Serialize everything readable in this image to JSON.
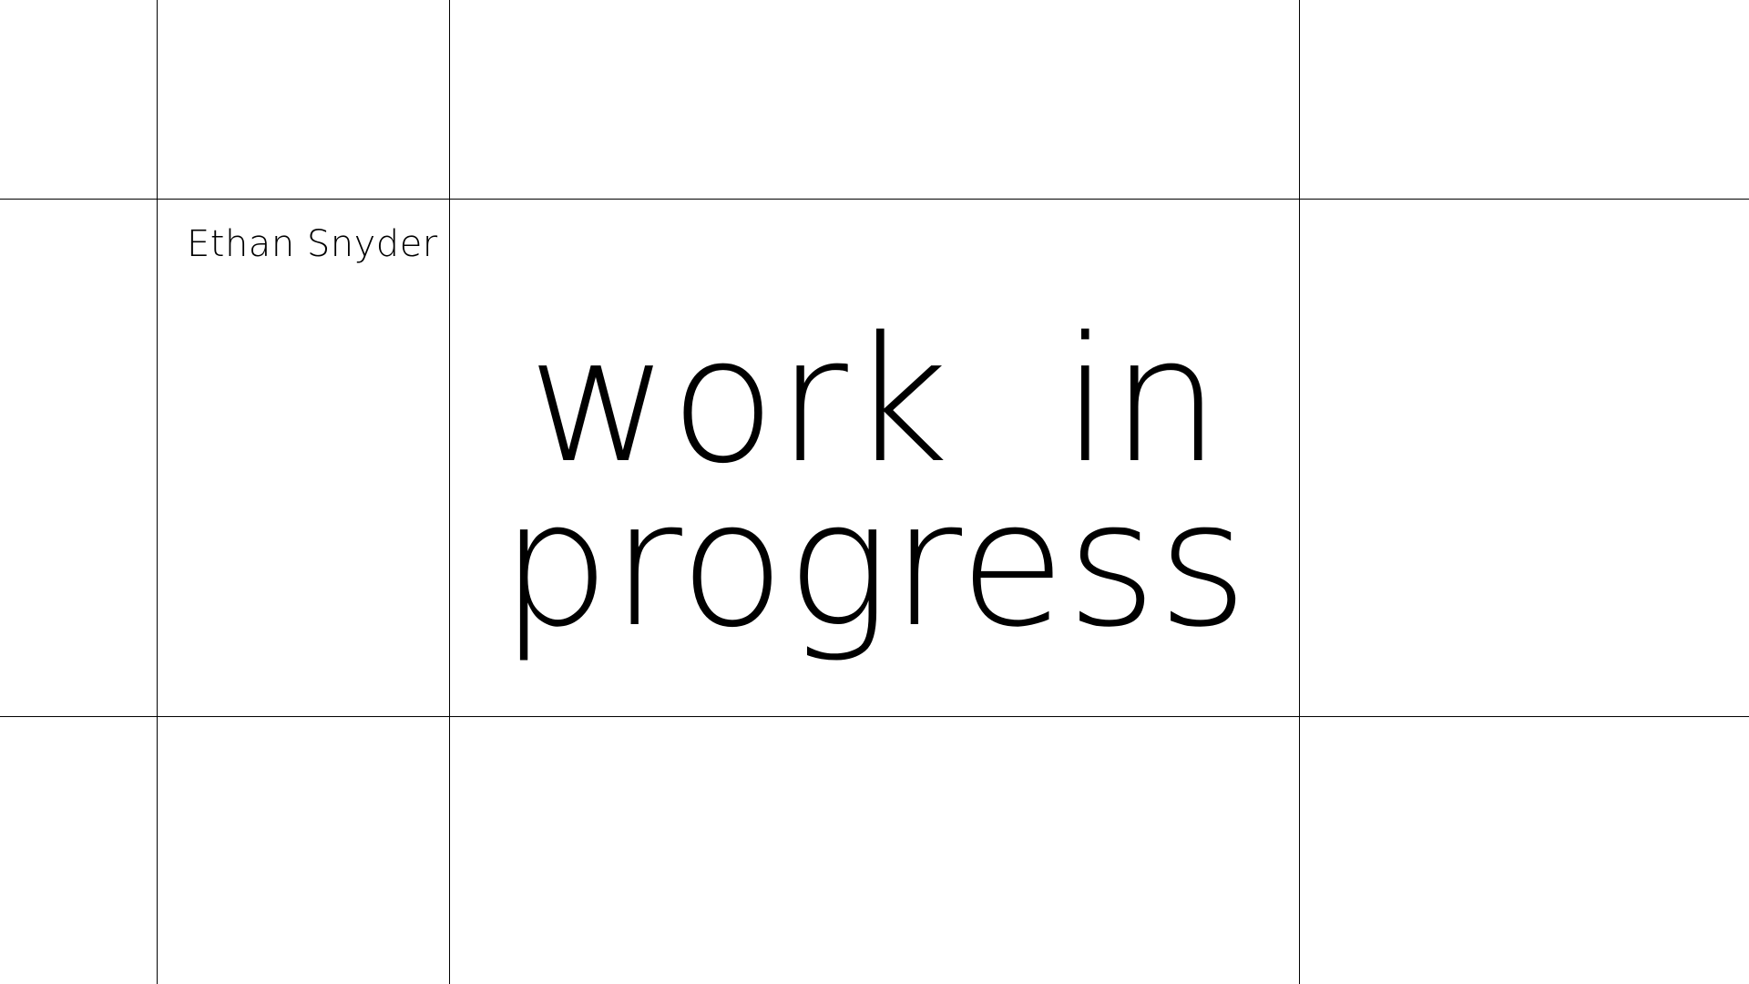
{
  "author": {
    "name": "Ethan Snyder"
  },
  "headline": {
    "line1": "work  in",
    "line2": "progress"
  }
}
